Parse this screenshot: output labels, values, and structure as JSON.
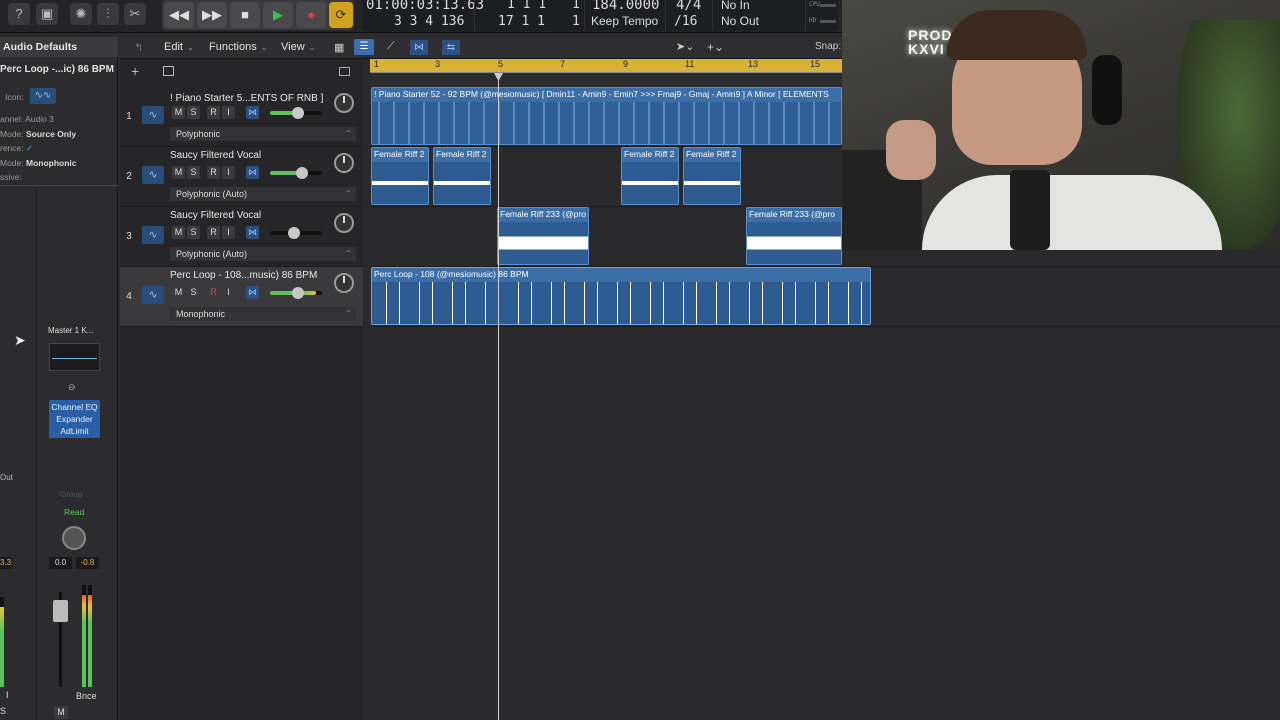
{
  "transport": {
    "position_time": "01:00:03:13.63",
    "position_bars": "3  3  4  136",
    "cycle_start": "1  1  1",
    "cycle_start_tick": "1",
    "cycle_end": "17  1  1",
    "cycle_end_tick": "1",
    "tempo": "184.0000",
    "tempo_mode": "Keep Tempo",
    "time_signature": "4/4",
    "division": "/16",
    "midi_in": "No In",
    "midi_out": "No Out",
    "cpu_label": "CPU",
    "hd_label": "HD"
  },
  "toolbar": {
    "edit": "Edit",
    "functions": "Functions",
    "view": "View",
    "snap": "Snap:"
  },
  "inspector": {
    "title": "Audio Defaults",
    "region_name": "Perc Loop -...ic) 86 BPM",
    "icon_label": "Icon:",
    "channel_label": "annel:",
    "channel_value": "Audio 3",
    "mode_label": "Mode:",
    "mode_value": "Source Only",
    "reference_label": "rence:",
    "reference_value": "✓",
    "mode2_label": "Mode:",
    "mode2_value": "Monophonic",
    "ssive_label": "ssive:",
    "master_label": "Master 1 K...",
    "plugins": [
      "Channel EQ",
      "Expander",
      "AdLimit"
    ],
    "group_label": "Group",
    "read_label": "Read",
    "vol_left": "0.0",
    "vol_right": "-0.8",
    "out_label": "Out",
    "bnce_label": "Bnce",
    "m_label": "M",
    "s_label": "S",
    "i_label": "I",
    "left_val": "3.3"
  },
  "tracks": [
    {
      "num": "1",
      "name": "! Piano Starter 5...ENTS OF RNB ]",
      "mode": "Polyphonic"
    },
    {
      "num": "2",
      "name": "Saucy Filtered Vocal",
      "mode": "Polyphonic (Auto)"
    },
    {
      "num": "3",
      "name": "Saucy Filtered Vocal",
      "mode": "Polyphonic (Auto)"
    },
    {
      "num": "4",
      "name": "Perc Loop - 108...music) 86 BPM",
      "mode": "Monophonic"
    }
  ],
  "track_buttons": {
    "m": "M",
    "s": "S",
    "r": "R",
    "i": "I"
  },
  "ruler_bars": [
    "1",
    "3",
    "5",
    "7",
    "9",
    "11",
    "13",
    "15"
  ],
  "regions": {
    "piano": "! Piano Starter 52 - 92 BPM (@mesiomusic) [ Dmin11 - Amin9 - Emin7 >>> Fmaj9 - Gmaj - Amin9 ] A Minor [ ELEMENTS",
    "riff2": "Female Riff 2",
    "riff233": "Female Riff 233 (@pro",
    "perc": "Perc Loop - 108 (@mesiomusic)  86 BPM"
  },
  "webcam": {
    "neon_sign": "PROD KXVI"
  }
}
